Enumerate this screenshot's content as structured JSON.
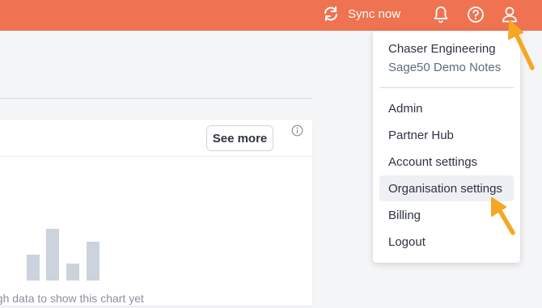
{
  "topbar": {
    "sync_label": "Sync now",
    "icons": [
      "sync-icon",
      "bell-icon",
      "help-icon",
      "user-icon"
    ],
    "background": "#ef7350"
  },
  "card": {
    "see_more_label": "See more",
    "empty_text": "ugh data to show this chart yet"
  },
  "menu": {
    "org_name": "Chaser Engineering",
    "org_sub": "Sage50 Demo Notes",
    "items": [
      {
        "label": "Admin"
      },
      {
        "label": "Partner Hub"
      },
      {
        "label": "Account settings"
      },
      {
        "label": "Organisation settings",
        "active": true
      },
      {
        "label": "Billing"
      },
      {
        "label": "Logout"
      }
    ]
  },
  "colors": {
    "accent": "#ef7350",
    "annotation_arrow": "#f5a623"
  }
}
